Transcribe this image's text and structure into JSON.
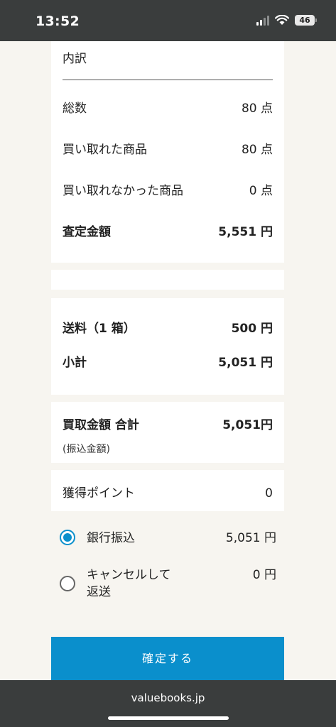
{
  "status_bar": {
    "time": "13:52",
    "battery": "46"
  },
  "breakdown": {
    "heading": "内訳",
    "rows": [
      {
        "label": "総数",
        "value": "80 点"
      },
      {
        "label": "買い取れた商品",
        "value": "80 点"
      },
      {
        "label": "買い取れなかった商品",
        "value": "0 点"
      }
    ],
    "appraisal": {
      "label": "査定金額",
      "value": "5,551 円"
    }
  },
  "fees": {
    "shipping": {
      "label": "送料（1 箱）",
      "value": "500 円"
    },
    "subtotal": {
      "label": "小計",
      "value": "5,051 円"
    }
  },
  "total": {
    "label": "買取金額 合計",
    "value": "5,051円",
    "note": "(振込金額)"
  },
  "points": {
    "label": "獲得ポイント",
    "value": "0"
  },
  "payment_options": [
    {
      "label": "銀行振込",
      "value": "5,051 円",
      "selected": true
    },
    {
      "label": "キャンセルして返送",
      "value": "0 円",
      "selected": false
    }
  ],
  "confirm_button": "確定する",
  "browser": {
    "url": "valuebooks.jp"
  }
}
